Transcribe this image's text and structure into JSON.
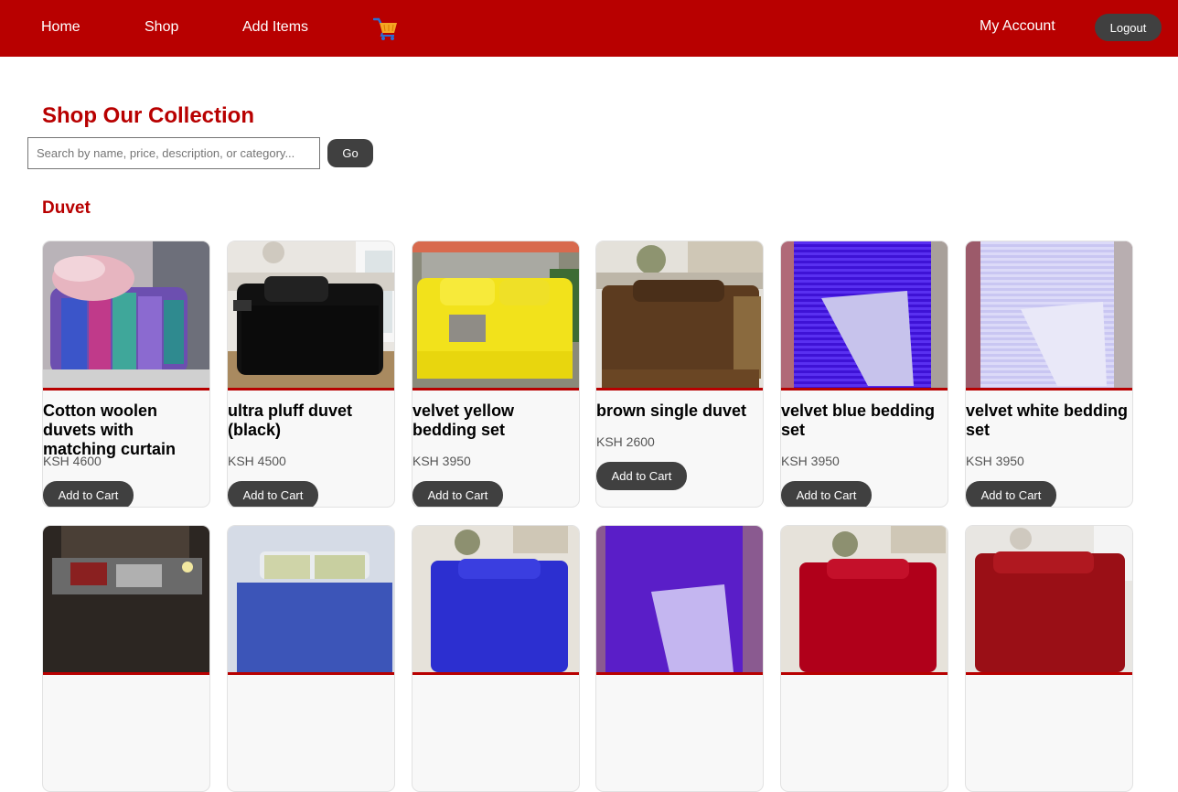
{
  "nav": {
    "home": "Home",
    "shop": "Shop",
    "add_items": "Add Items",
    "cart_icon": "shopping-cart-icon",
    "my_account": "My Account",
    "logout": "Logout"
  },
  "page": {
    "title": "Shop Our Collection"
  },
  "search": {
    "placeholder": "Search by name, price, description, or category...",
    "value": "",
    "go_label": "Go"
  },
  "category": {
    "name": "Duvet",
    "add_to_cart_label": "Add to Cart",
    "products": [
      {
        "title": "Cotton woolen duvets with matching curtain",
        "price": "KSH 4600",
        "image": "stack of patterned duvets"
      },
      {
        "title": "ultra pluff duvet (black)",
        "price": "KSH 4500",
        "image": "black fluffy duvet on bed"
      },
      {
        "title": "velvet yellow bedding set",
        "price": "KSH 3950",
        "image": "yellow velvet bedding set"
      },
      {
        "title": "brown single duvet",
        "price": "KSH 2600",
        "image": "brown duvet on bed"
      },
      {
        "title": "velvet blue bedding set",
        "price": "KSH 3950",
        "image": "blue velvet duvet folded"
      },
      {
        "title": "velvet white bedding set",
        "price": "KSH 3950",
        "image": "white velvet duvet folded"
      }
    ],
    "next_row_images": [
      "dark grey bedding in bedroom",
      "blue patterned pillows on bed",
      "royal blue duvet on bed",
      "purple velvet duvet folded",
      "red duvet on bed",
      "red fluffy duvet on bed"
    ]
  },
  "colors": {
    "brand_red": "#b80000",
    "button_dark": "#404040",
    "card_bg": "#f8f8f8"
  }
}
